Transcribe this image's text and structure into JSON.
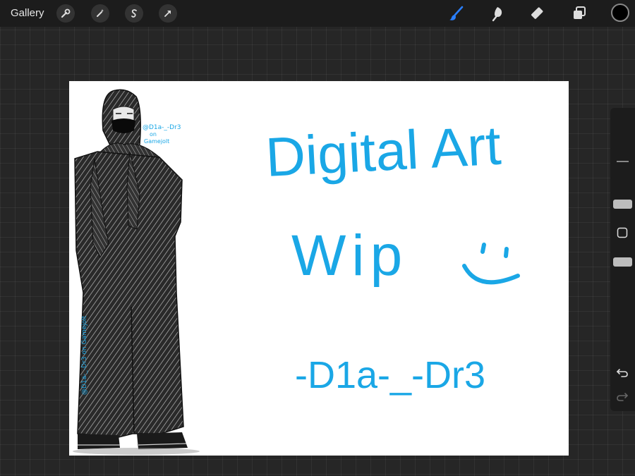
{
  "topbar": {
    "gallery_label": "Gallery",
    "left_tools": [
      "wrench-icon",
      "magic-wand-icon",
      "selection-s-icon",
      "transform-arrow-icon"
    ],
    "right_tools": [
      "brush-icon",
      "smudge-icon",
      "eraser-icon",
      "layers-icon"
    ],
    "active_tool": "brush-icon",
    "current_color": "#000000",
    "accent_color": "#2a7fff"
  },
  "canvas": {
    "background": "#ffffff",
    "handwriting_color": "#1aa7e6",
    "line1": "Digital Art",
    "line2": "Wip",
    "smiley": ":)",
    "signature": "-D1a-_-Dr3",
    "watermark_top": [
      "@D1a-_-Dr3",
      "on",
      "Gamejolt"
    ],
    "watermark_side": "@D1a-_-Dr3 on Gamejolt"
  },
  "sidebar": {
    "size_slider_level": 0.35,
    "opacity_slider_level": 0.75,
    "buttons": [
      "square-modify-icon",
      "undo-icon",
      "redo-icon"
    ]
  }
}
